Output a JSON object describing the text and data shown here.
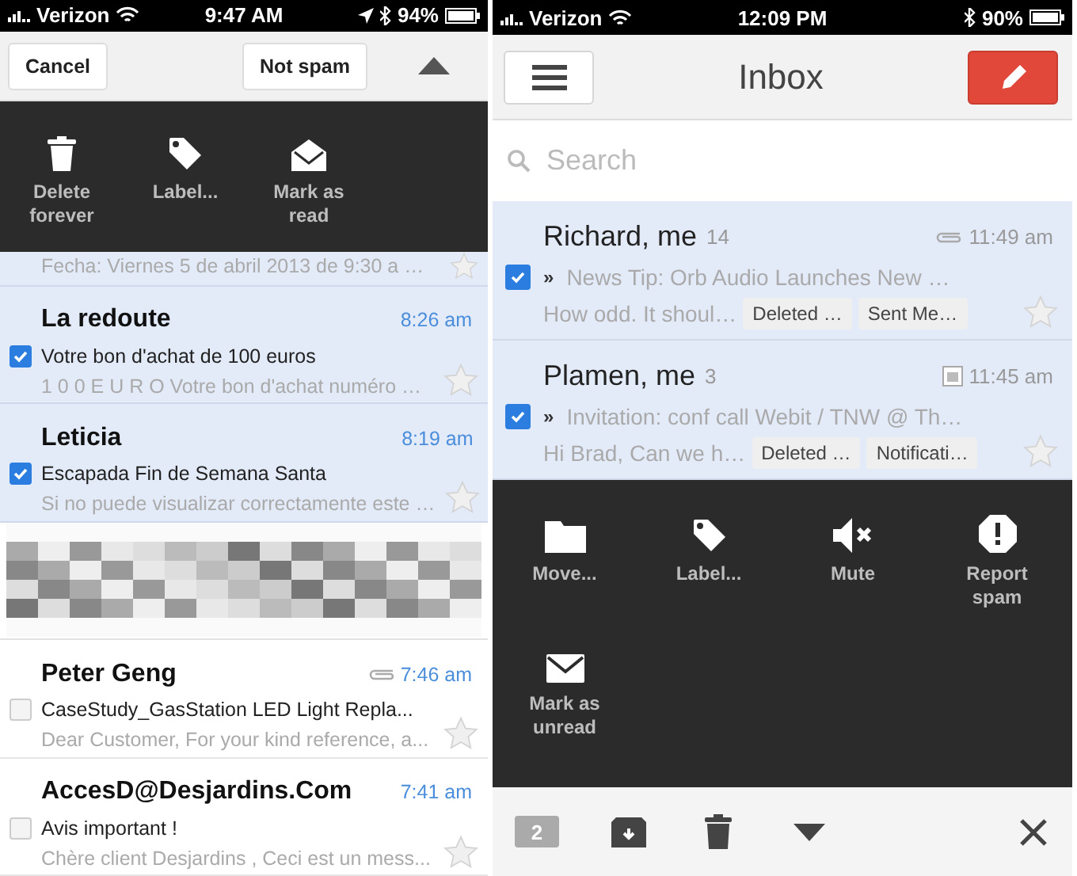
{
  "left_screen": {
    "status_bar": {
      "carrier": "Verizon",
      "time": "9:47 AM",
      "battery": "94%",
      "location": true
    },
    "toolbar": {
      "cancel": "Cancel",
      "not_spam": "Not spam"
    },
    "action_menu": [
      {
        "kind": "trash",
        "label": "Delete forever"
      },
      {
        "kind": "tag",
        "label": "Label..."
      },
      {
        "kind": "envelope-open",
        "label": "Mark as read"
      }
    ],
    "partial_row": {
      "preview": "Fecha: Viernes 5 de abril 2013 de 9:30 a …",
      "selected": true
    },
    "messages": [
      {
        "kind": "message",
        "sender": "La redoute",
        "time": "8:26 am",
        "subject": "Votre bon d'achat de 100 euros",
        "preview": "1 0 0 E U R O Votre bon d'achat numéro …",
        "selected": true,
        "attachment": false
      },
      {
        "kind": "message",
        "sender": "Leticia",
        "time": "8:19 am",
        "subject": "Escapada Fin de Semana Santa",
        "preview": "Si no puede visualizar correctamente este …",
        "selected": true,
        "attachment": false
      },
      {
        "kind": "blurred"
      },
      {
        "kind": "message",
        "sender": "Peter Geng",
        "time": "7:46 am",
        "subject": "CaseStudy_GasStation LED Light Repla...",
        "preview": "Dear Customer, For your kind reference, a...",
        "selected": false,
        "attachment": true
      },
      {
        "kind": "message",
        "sender": "AccesD@Desjardins.Com",
        "time": "7:41 am",
        "subject": "Avis important !",
        "preview": "Chère client Desjardins , Ceci est un mess...",
        "selected": false,
        "attachment": false
      }
    ]
  },
  "right_screen": {
    "status_bar": {
      "carrier": "Verizon",
      "time": "12:09 PM",
      "battery": "90%",
      "location": false
    },
    "header": {
      "title": "Inbox"
    },
    "search": {
      "placeholder": "Search"
    },
    "conversations": [
      {
        "kind": "attachment",
        "sender": "Richard, me",
        "count": "14",
        "time": "11:49 am",
        "marker": "»",
        "subject": "News Tip: Orb Audio Launches New …",
        "snippet": "How odd. It shoul…",
        "labels": [
          "Deleted …",
          "Sent Me…"
        ],
        "selected": true
      },
      {
        "kind": "calendar",
        "sender": "Plamen, me",
        "count": "3",
        "time": "11:45 am",
        "marker": "»",
        "subject": "Invitation: conf call Webit / TNW @ Th…",
        "snippet": "Hi Brad, Can we h…",
        "labels": [
          "Deleted …",
          "Notificati…"
        ],
        "selected": true
      }
    ],
    "action_menu": [
      {
        "kind": "folder",
        "label": "Move..."
      },
      {
        "kind": "tag",
        "label": "Label..."
      },
      {
        "kind": "mute",
        "label": "Mute"
      },
      {
        "kind": "alert",
        "label": "Report spam"
      },
      {
        "kind": "envelope",
        "label": "Mark as unread"
      }
    ],
    "bottom_bar": {
      "selected_count": "2"
    }
  }
}
